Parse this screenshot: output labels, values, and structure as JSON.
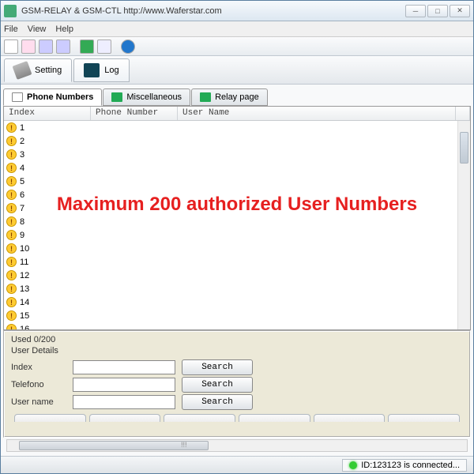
{
  "window": {
    "title": "GSM-RELAY & GSM-CTL      http://www.Waferstar.com"
  },
  "menu": {
    "file": "File",
    "view": "View",
    "help": "Help"
  },
  "bigtabs": {
    "setting": "Setting",
    "log": "Log"
  },
  "tabs": {
    "phone": "Phone Numbers",
    "misc": "Miscellaneous",
    "relay": "Relay page"
  },
  "grid": {
    "cols": {
      "index": "Index",
      "phone": "Phone Number",
      "user": "User Name"
    },
    "rows": [
      "1",
      "2",
      "3",
      "4",
      "5",
      "6",
      "7",
      "8",
      "9",
      "10",
      "11",
      "12",
      "13",
      "14",
      "15",
      "16"
    ]
  },
  "overlay": "Maximum 200 authorized User Numbers",
  "details": {
    "counter": "Used 0/200",
    "header": "User Details",
    "index": "Index",
    "telefono": "Telefono",
    "username": "User name",
    "search": "Search"
  },
  "hscroll_mark": "!!!",
  "status": {
    "text": "ID:123123 is connected..."
  }
}
